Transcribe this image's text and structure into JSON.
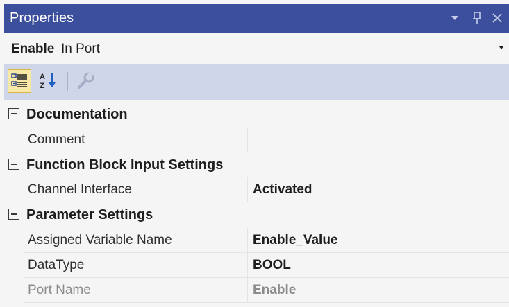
{
  "window": {
    "title": "Properties",
    "dropdown_icon": "triangle-down-icon",
    "pin_icon": "pin-icon",
    "close_icon": "close-icon"
  },
  "selection": {
    "object_name": "Enable",
    "object_type": "In Port"
  },
  "toolbar": {
    "buttons": [
      {
        "icon": "categorized-icon",
        "active": true
      },
      {
        "icon": "alphabetical-icon",
        "active": false
      },
      {
        "icon": "property-pages-icon",
        "active": false,
        "enabled": false
      }
    ]
  },
  "categories": [
    {
      "label": "Documentation",
      "properties": [
        {
          "name": "Comment",
          "value": ""
        }
      ]
    },
    {
      "label": "Function Block Input Settings",
      "properties": [
        {
          "name": "Channel Interface",
          "value": "Activated"
        }
      ]
    },
    {
      "label": "Parameter Settings",
      "properties": [
        {
          "name": "Assigned Variable Name",
          "value": "Enable_Value"
        },
        {
          "name": "DataType",
          "value": "BOOL"
        },
        {
          "name": "Port Name",
          "value": "Enable",
          "readonly": true
        }
      ]
    }
  ],
  "colors": {
    "titlebar": "#3c4f9c",
    "toolbar": "#cfd6ea",
    "active_button": "#f9e8a6",
    "readonly_text": "#8c8c8c"
  }
}
